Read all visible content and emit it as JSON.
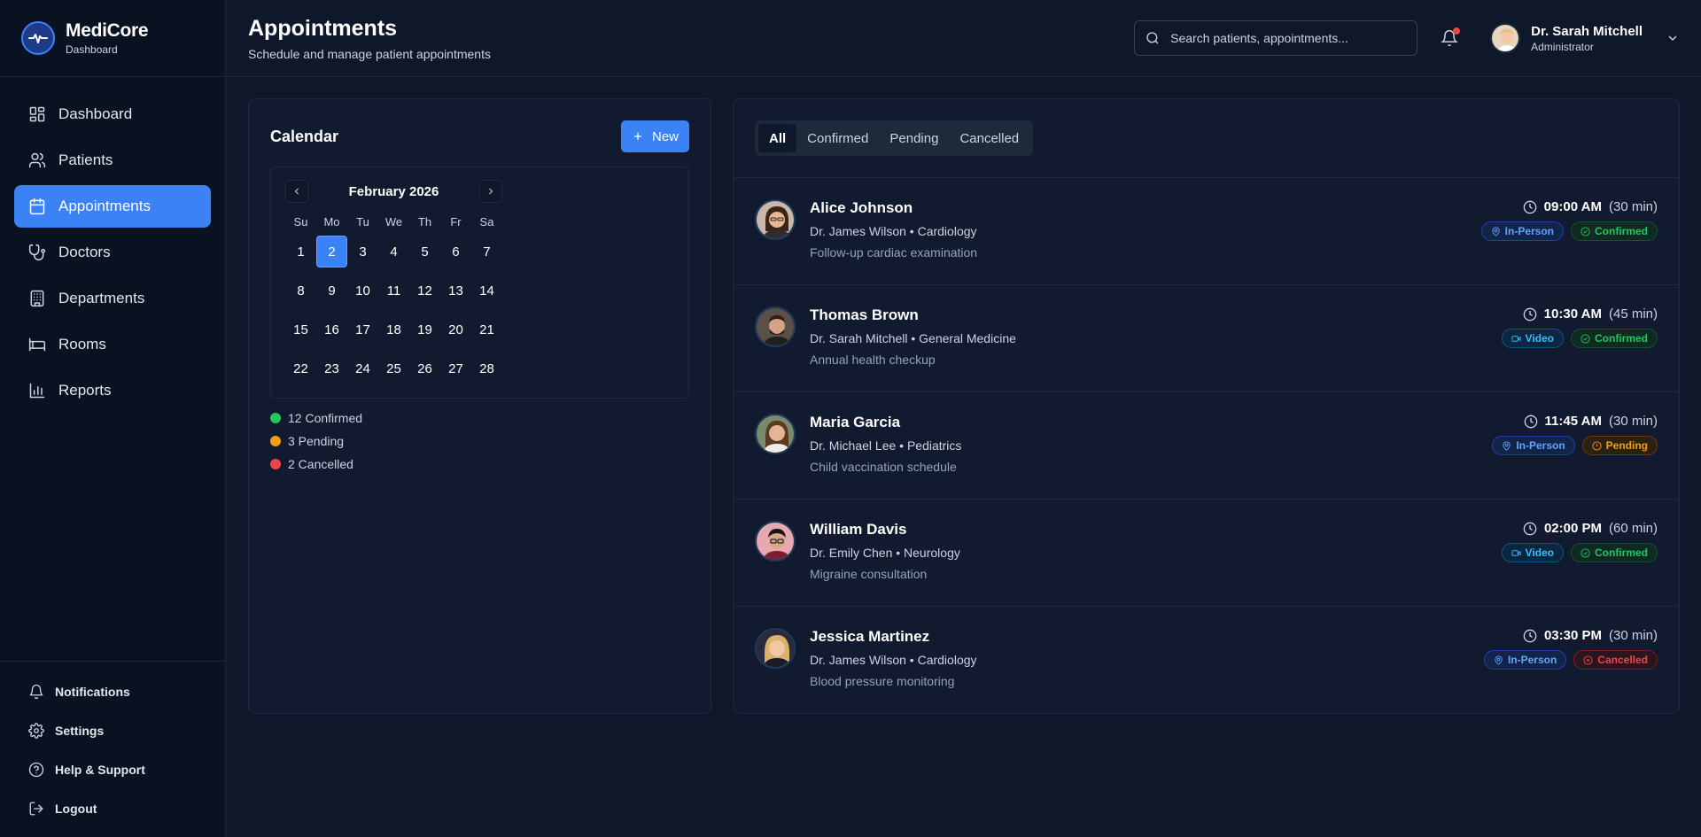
{
  "brand": {
    "name": "MediCore",
    "subtitle": "Dashboard"
  },
  "sidebar": {
    "items": [
      {
        "label": "Dashboard",
        "icon": "grid-icon"
      },
      {
        "label": "Patients",
        "icon": "users-icon"
      },
      {
        "label": "Appointments",
        "icon": "calendar-icon",
        "active": true
      },
      {
        "label": "Doctors",
        "icon": "stethoscope-icon"
      },
      {
        "label": "Departments",
        "icon": "building-icon"
      },
      {
        "label": "Rooms",
        "icon": "bed-icon"
      },
      {
        "label": "Reports",
        "icon": "bar-chart-icon"
      }
    ],
    "bottom": [
      {
        "label": "Notifications",
        "icon": "bell-icon"
      },
      {
        "label": "Settings",
        "icon": "gear-icon"
      },
      {
        "label": "Help & Support",
        "icon": "help-icon"
      },
      {
        "label": "Logout",
        "icon": "logout-icon"
      }
    ]
  },
  "header": {
    "title": "Appointments",
    "subtitle": "Schedule and manage patient appointments",
    "search_placeholder": "Search patients, appointments...",
    "user": {
      "name": "Dr. Sarah Mitchell",
      "role": "Administrator"
    }
  },
  "calendar": {
    "title": "Calendar",
    "new_label": "New",
    "month": "February 2026",
    "weekdays": [
      "Su",
      "Mo",
      "Tu",
      "We",
      "Th",
      "Fr",
      "Sa"
    ],
    "weeks": [
      [
        "1",
        "2",
        "3",
        "4",
        "5",
        "6",
        "7"
      ],
      [
        "8",
        "9",
        "10",
        "11",
        "12",
        "13",
        "14"
      ],
      [
        "15",
        "16",
        "17",
        "18",
        "19",
        "20",
        "21"
      ],
      [
        "22",
        "23",
        "24",
        "25",
        "26",
        "27",
        "28"
      ]
    ],
    "selected_day": "2",
    "legend": [
      {
        "label": "12 Confirmed",
        "color": "#22c55e"
      },
      {
        "label": "3 Pending",
        "color": "#f59e0b"
      },
      {
        "label": "2 Cancelled",
        "color": "#ef4444"
      }
    ]
  },
  "tabs": [
    {
      "label": "All",
      "active": true
    },
    {
      "label": "Confirmed"
    },
    {
      "label": "Pending"
    },
    {
      "label": "Cancelled"
    }
  ],
  "appointments": [
    {
      "name": "Alice Johnson",
      "doctor": "Dr. James Wilson • Cardiology",
      "note": "Follow-up cardiac examination",
      "time": "09:00 AM",
      "duration": "(30 min)",
      "type": "In-Person",
      "status": "Confirmed"
    },
    {
      "name": "Thomas Brown",
      "doctor": "Dr. Sarah Mitchell • General Medicine",
      "note": "Annual health checkup",
      "time": "10:30 AM",
      "duration": "(45 min)",
      "type": "Video",
      "status": "Confirmed"
    },
    {
      "name": "Maria Garcia",
      "doctor": "Dr. Michael Lee • Pediatrics",
      "note": "Child vaccination schedule",
      "time": "11:45 AM",
      "duration": "(30 min)",
      "type": "In-Person",
      "status": "Pending"
    },
    {
      "name": "William Davis",
      "doctor": "Dr. Emily Chen • Neurology",
      "note": "Migraine consultation",
      "time": "02:00 PM",
      "duration": "(60 min)",
      "type": "Video",
      "status": "Confirmed"
    },
    {
      "name": "Jessica Martinez",
      "doctor": "Dr. James Wilson • Cardiology",
      "note": "Blood pressure monitoring",
      "time": "03:30 PM",
      "duration": "(30 min)",
      "type": "In-Person",
      "status": "Cancelled"
    }
  ]
}
